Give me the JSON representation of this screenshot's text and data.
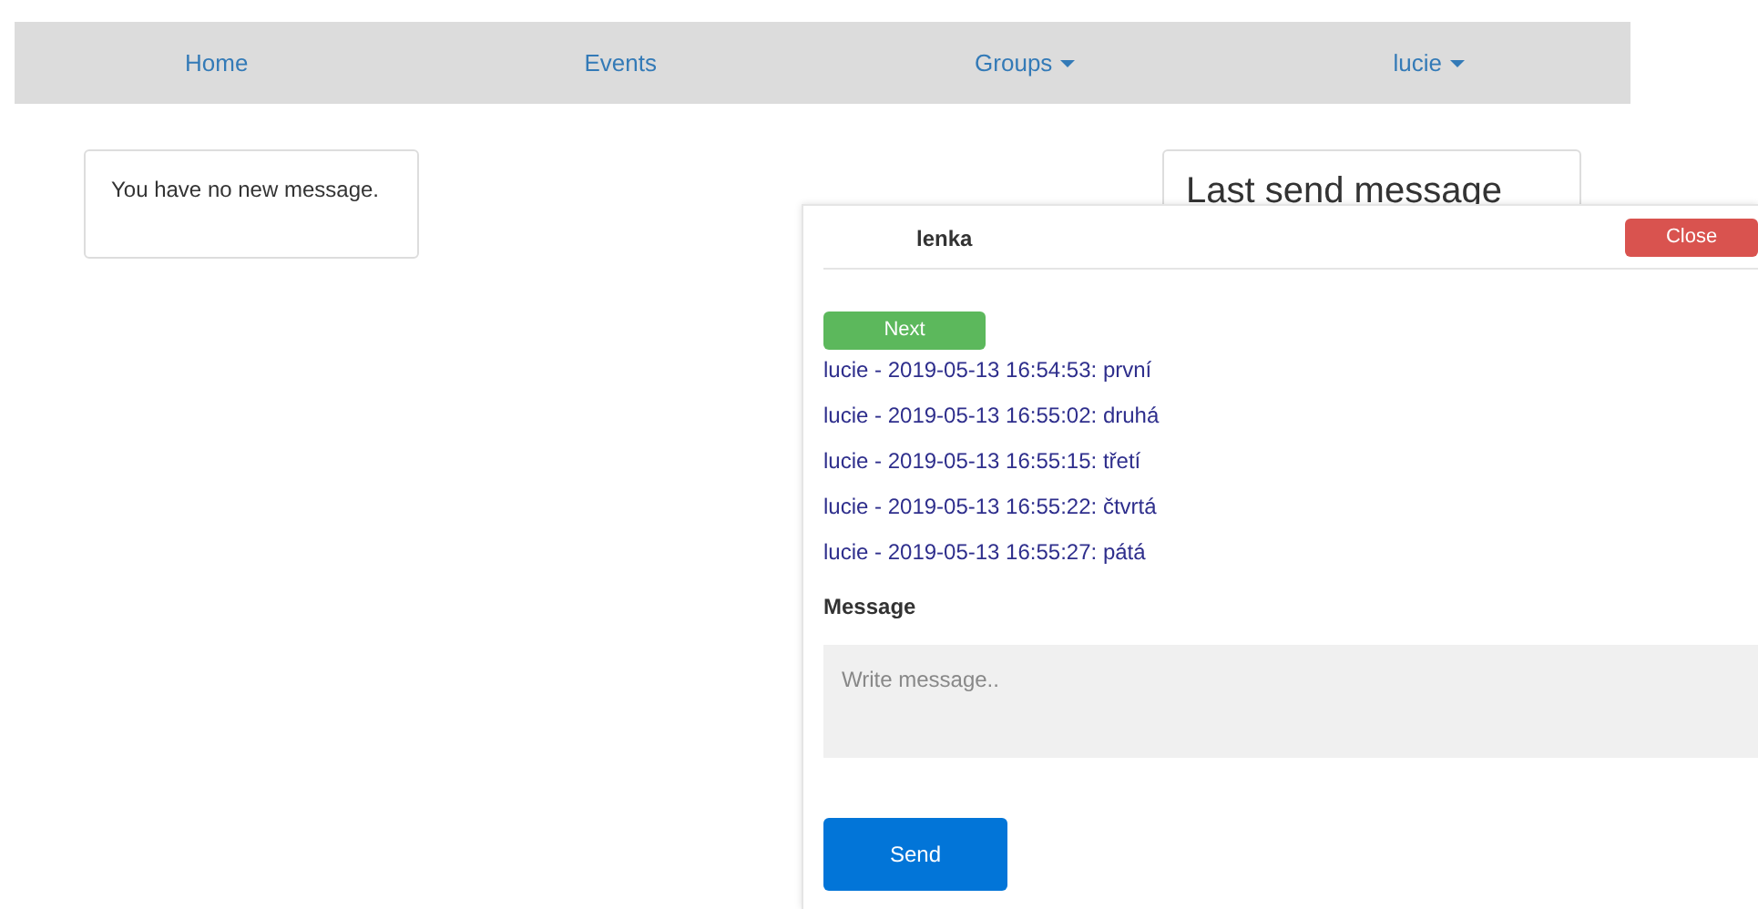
{
  "nav": [
    {
      "label": "Home",
      "kind": "link"
    },
    {
      "label": "Events",
      "kind": "link"
    },
    {
      "label": "Groups",
      "kind": "dropdown"
    },
    {
      "label": "lucie",
      "kind": "dropdown"
    }
  ],
  "inbox": {
    "text": "You have no new message."
  },
  "last_sent": {
    "title": "Last send message"
  },
  "chat": {
    "recipient": "lenka",
    "close": "Close",
    "next": "Next",
    "messages": [
      "lucie - 2019-05-13 16:54:53: první",
      "lucie - 2019-05-13 16:55:02: druhá",
      "lucie - 2019-05-13 16:55:15: třetí",
      "lucie - 2019-05-13 16:55:22: čtvrtá",
      "lucie - 2019-05-13 16:55:27: pátá"
    ],
    "message_label": "Message",
    "placeholder": "Write message..",
    "send": "Send"
  }
}
